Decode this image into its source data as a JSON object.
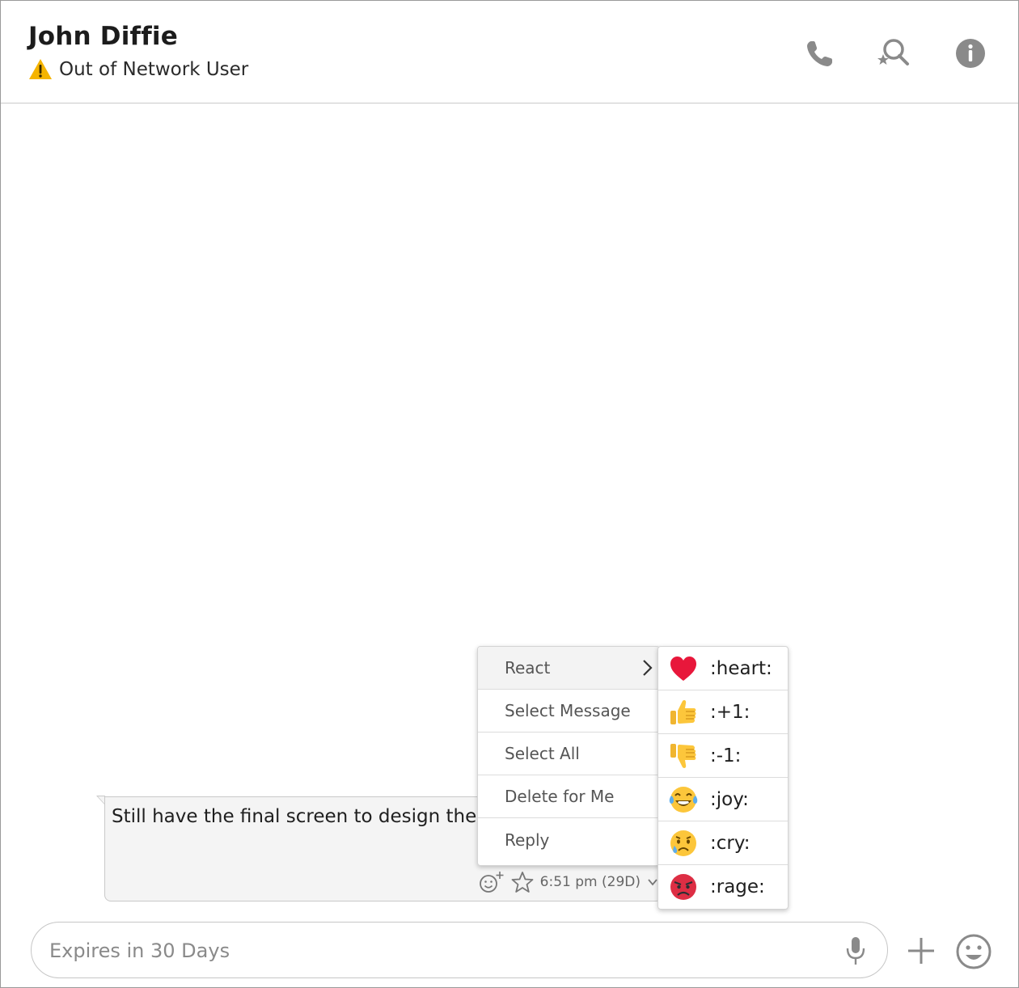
{
  "header": {
    "name": "John Diffie",
    "status": "Out of Network User",
    "icons": [
      "phone-icon",
      "search-star-icon",
      "info-icon"
    ]
  },
  "message": {
    "text": "Still have the final screen to design the Invision.",
    "time": "6:51 pm (29D)"
  },
  "context_menu": {
    "items": [
      {
        "label": "React",
        "has_submenu": true
      },
      {
        "label": "Select Message"
      },
      {
        "label": "Select All"
      },
      {
        "label": "Delete for Me"
      },
      {
        "label": "Reply"
      }
    ]
  },
  "reactions": [
    {
      "label": ":heart:",
      "icon": "heart-emoji-icon"
    },
    {
      "label": ":+1:",
      "icon": "thumbs-up-emoji-icon"
    },
    {
      "label": ":-1:",
      "icon": "thumbs-down-emoji-icon"
    },
    {
      "label": ":joy:",
      "icon": "joy-emoji-icon"
    },
    {
      "label": ":cry:",
      "icon": "cry-emoji-icon"
    },
    {
      "label": ":rage:",
      "icon": "rage-emoji-icon"
    }
  ],
  "composer": {
    "placeholder": "Expires in 30 Days"
  },
  "colors": {
    "icon_gray": "#8a8a8a",
    "warning": "#f5b400",
    "heart": "#e8173b"
  }
}
